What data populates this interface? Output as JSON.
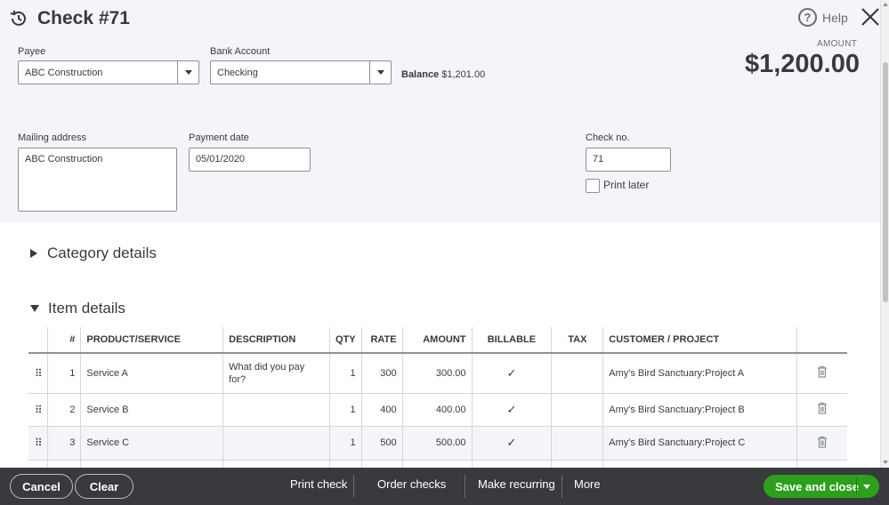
{
  "header": {
    "title": "Check #71",
    "help_label": "Help"
  },
  "form": {
    "payee_label": "Payee",
    "payee_value": "ABC Construction",
    "bank_label": "Bank Account",
    "bank_value": "Checking",
    "balance_label": "Balance",
    "balance_value": "$1,201.00",
    "amount_label": "AMOUNT",
    "amount_value": "$1,200.00",
    "mailing_label": "Mailing address",
    "mailing_value": "ABC Construction",
    "payment_date_label": "Payment date",
    "payment_date_value": "05/01/2020",
    "check_no_label": "Check no.",
    "check_no_value": "71",
    "print_later_label": "Print later"
  },
  "sections": {
    "category": "Category details",
    "item": "Item details"
  },
  "table": {
    "headers": {
      "num": "#",
      "product": "PRODUCT/SERVICE",
      "description": "DESCRIPTION",
      "qty": "QTY",
      "rate": "RATE",
      "amount": "AMOUNT",
      "billable": "BILLABLE",
      "tax": "TAX",
      "customer": "CUSTOMER / PROJECT"
    },
    "description_placeholder": "What did you pay for?",
    "rows": [
      {
        "num": "1",
        "product": "Service A",
        "qty": "1",
        "rate": "300",
        "amount": "300.00",
        "customer": "Amy's Bird Sanctuary:Project A"
      },
      {
        "num": "2",
        "product": "Service B",
        "qty": "1",
        "rate": "400",
        "amount": "400.00",
        "customer": "Amy's Bird Sanctuary:Project B"
      },
      {
        "num": "3",
        "product": "Service C",
        "qty": "1",
        "rate": "500",
        "amount": "500.00",
        "customer": "Amy's Bird Sanctuary:Project C"
      }
    ]
  },
  "footer": {
    "cancel": "Cancel",
    "clear": "Clear",
    "print_check": "Print check",
    "order_checks": "Order checks",
    "make_recurring": "Make recurring",
    "more": "More",
    "save_close": "Save and close"
  },
  "colors": {
    "accent_green": "#2ca01c",
    "footer_bg": "#393a3d",
    "header_bg": "#f4f5f8"
  }
}
